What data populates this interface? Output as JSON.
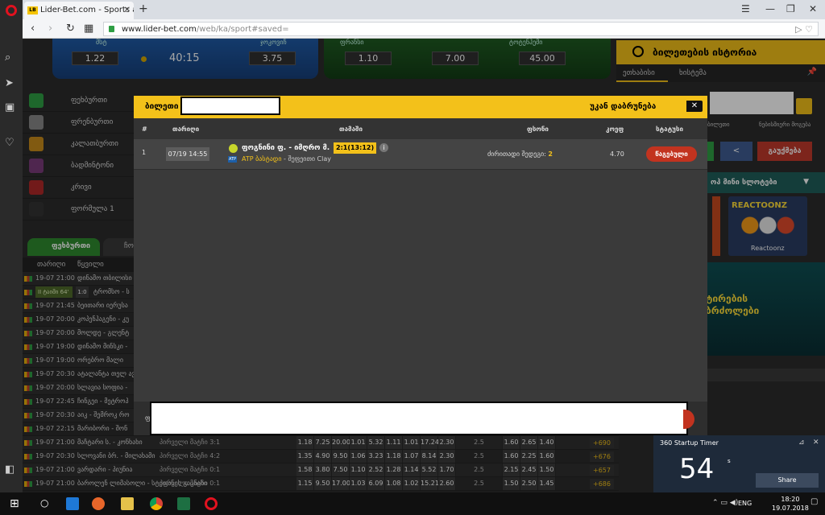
{
  "browser": {
    "tab_title": "Lider-Bet.com - Sports an",
    "tab_logo": "LB",
    "url_host": "www.lider-bet.com",
    "url_path": "/web/ka/sport#saved="
  },
  "banners": {
    "tennis": {
      "team_left": "მსტ",
      "team_right": "ჯოკოვიჩ",
      "odd_left": "1.22",
      "clock": "40:15",
      "odd_right": "3.75"
    },
    "football": {
      "team_left": "ფრანსი",
      "team_right": "ტოტენჰემი",
      "odd_1": "1.10",
      "odd_2": "7.00",
      "odd_3": "45.00"
    }
  },
  "history": {
    "title": "ბილეთების ისტორია",
    "tab_live": "ეთხაბისი",
    "tab_all": "ხისტემა"
  },
  "sports": [
    {
      "label": "ფეხბურთი",
      "color": "#2e9e44"
    },
    {
      "label": "ფრენბურთი",
      "color": "#888888"
    },
    {
      "label": "კალათბურთი",
      "color": "#c78a1b"
    },
    {
      "label": "ბადმინტონი",
      "color": "#7a3b7a"
    },
    {
      "label": "კრივი",
      "color": "#b02828"
    },
    {
      "label": "ფორმულა 1",
      "color": "#333333"
    }
  ],
  "sport_tabs": {
    "football": "ფეხბურთი",
    "tennis": "ჩოგ"
  },
  "list_header": {
    "date": "თარიღი",
    "event": "წყვილი"
  },
  "live_row": {
    "time": "II ტაიმი 64'",
    "score": "1:0",
    "name": "ტრომსო - ს"
  },
  "matches": [
    {
      "date": "19-07 21:00",
      "name": "დინამო თბილისი"
    },
    {
      "date": "19-07 21:45",
      "name": "ბეითარი იერუსა"
    },
    {
      "date": "19-07 20:00",
      "name": "კოპენჰაგენი - კუ"
    },
    {
      "date": "19-07 20:00",
      "name": "მოლდე - გლენტ"
    },
    {
      "date": "19-07 19:00",
      "name": "დინამო მინსკი - "
    },
    {
      "date": "19-07 19:00",
      "name": "ორებრო მალი"
    },
    {
      "date": "19-07 20:30",
      "name": "ატალანტა თელ ავივ"
    },
    {
      "date": "19-07 20:00",
      "name": "სლავია სოფია - "
    },
    {
      "date": "19-07 22:45",
      "name": "ჩინგეი - მეტროპ"
    },
    {
      "date": "19-07 20:30",
      "name": "აიკ - შემროკ რო"
    },
    {
      "date": "19-07 22:15",
      "name": "მარიბორი - შონ"
    },
    {
      "date": "19-07 21:00",
      "name": "მაჩტარი ს. - კონხახი",
      "score": "პირველი მატჩი 3:1",
      "odds": [
        "1.18",
        "7.25",
        "20.00",
        "1.01",
        "5.32",
        "1.11",
        "1.01",
        "17.24",
        "2.30",
        "2.5",
        "1.60",
        "2.65",
        "1.40"
      ],
      "more": "+690"
    },
    {
      "date": "19-07 20:30",
      "name": "სლოვანი ბრ. - მილახამი",
      "score": "პირველი მატჩი 4:2",
      "odds": [
        "1.35",
        "4.90",
        "9.50",
        "1.06",
        "3.23",
        "1.18",
        "1.07",
        "8.14",
        "2.30",
        "2.5",
        "1.60",
        "2.25",
        "1.60"
      ],
      "more": "+676"
    },
    {
      "date": "19-07 21:00",
      "name": "ვარდარი - პიუნია",
      "score": "პირველი მატჩი 0:1",
      "odds": [
        "1.58",
        "3.80",
        "7.50",
        "1.10",
        "2.52",
        "1.28",
        "1.14",
        "5.52",
        "1.70",
        "2.5",
        "2.15",
        "2.45",
        "1.50"
      ],
      "more": "+657"
    },
    {
      "date": "19-07 21:00",
      "name": "ბაროლენ ლიმასოლი - სტეფანის გაცნასი",
      "score": "პირველი მატჩი 0:1",
      "odds": [
        "1.15",
        "9.50",
        "17.00",
        "1.03",
        "6.09",
        "1.08",
        "1.02",
        "15.21",
        "2.60",
        "2.5",
        "1.50",
        "2.50",
        "1.45"
      ],
      "more": "+686"
    }
  ],
  "right_col": {
    "link_1": "ბილეთი",
    "link_2": "ნებისმიერი მოგება",
    "delete": "გაუქმება",
    "games_header": "ოპ მინი სლოტები",
    "game_title": "REACTOONZ",
    "game_label": "Reactoonz",
    "promo": "ტირების\nბრძოლები"
  },
  "modal": {
    "title": "ბილეთი",
    "back": "უკან დაბრუნება",
    "columns": {
      "num": "#",
      "date": "თარიღი",
      "match": "თამაში",
      "bet": "ფსონი",
      "coef": "კოეფ",
      "status": "სტატუსი"
    },
    "row": {
      "num": "1",
      "date": "07/19 14:55",
      "match": "ფოგნინი ფ. - იმღრო მ.",
      "score": "2:1(13:12)",
      "league": "ATP ბასტადი",
      "surface": " - შეფეითი Clay",
      "bet_label": "ძირითადი შედეგი: ",
      "bet_value": "2",
      "coef": "4.70",
      "status": "წაგებული"
    }
  },
  "toast": {
    "title": "360 Startup Timer",
    "count": "54",
    "unit": "s",
    "share": "Share"
  },
  "taskbar": {
    "lang": "ENG",
    "time": "18:20",
    "date": "19.07.2018"
  },
  "colors": {
    "accent": "#f3c11a",
    "loss": "#c2331f",
    "opera": "#e1121f"
  }
}
